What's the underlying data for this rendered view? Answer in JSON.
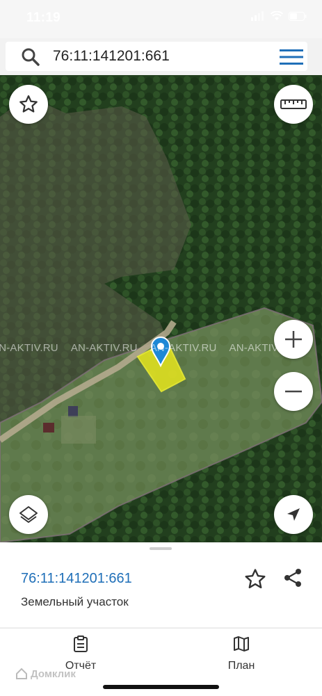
{
  "status": {
    "time": "11:19"
  },
  "search": {
    "query": "76:11:141201:661"
  },
  "map": {
    "watermark": [
      "AN-AKTIV.RU",
      "AN-AKTIV.RU",
      "AN-AKTIV.RU",
      "AN-AKTIV.RU"
    ],
    "plot_color": "#e6e61e",
    "marker_color": "#1e88d6"
  },
  "sheet": {
    "cadastral_number": "76:11:141201:661",
    "object_type": "Земельный участок"
  },
  "tabs": [
    {
      "label": "Отчёт",
      "icon": "report-icon"
    },
    {
      "label": "План",
      "icon": "map-book-icon"
    }
  ],
  "brand": {
    "name": "Домклик"
  }
}
